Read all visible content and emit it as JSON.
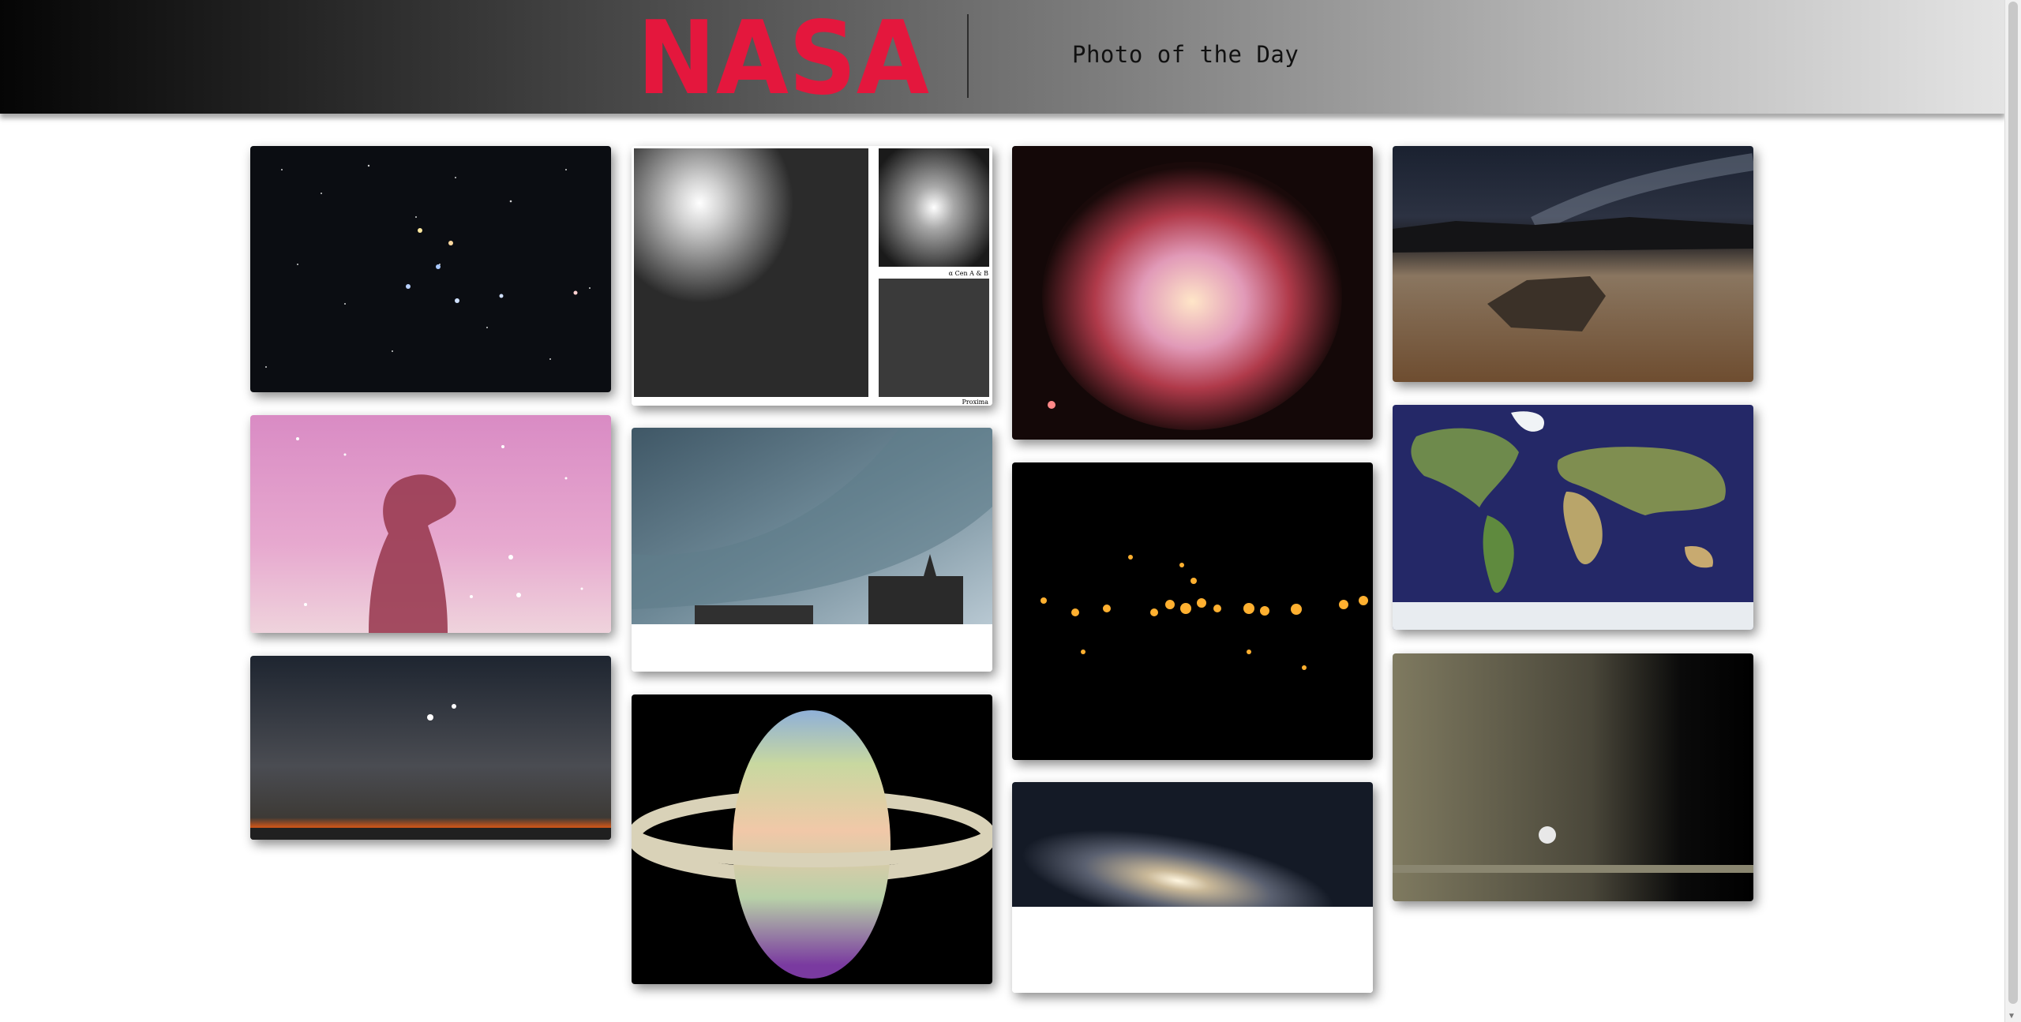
{
  "header": {
    "logo_text": "NASA",
    "title": "Photo of the Day"
  },
  "colors": {
    "brand_red": "#e4173d",
    "header_dark": "#050505",
    "header_light": "#e4e4e4"
  },
  "gallery": {
    "photos": [
      {
        "subject": "star field constellation"
      },
      {
        "subject": "bright star with inset panels"
      },
      {
        "subject": "planetary nebula"
      },
      {
        "subject": "desert sailing stone under milky way"
      },
      {
        "subject": "horsehead nebula"
      },
      {
        "subject": "shelf cloud over buildings"
      },
      {
        "subject": "galactic plane infrared sources"
      },
      {
        "subject": "world map earth"
      },
      {
        "subject": "zodiacal light horizon"
      },
      {
        "subject": "saturn false color"
      },
      {
        "subject": "spiral galaxy"
      },
      {
        "subject": "saturn rings and moon"
      }
    ],
    "inset_labels": [
      "α Cen A & B",
      "Proxima"
    ]
  }
}
